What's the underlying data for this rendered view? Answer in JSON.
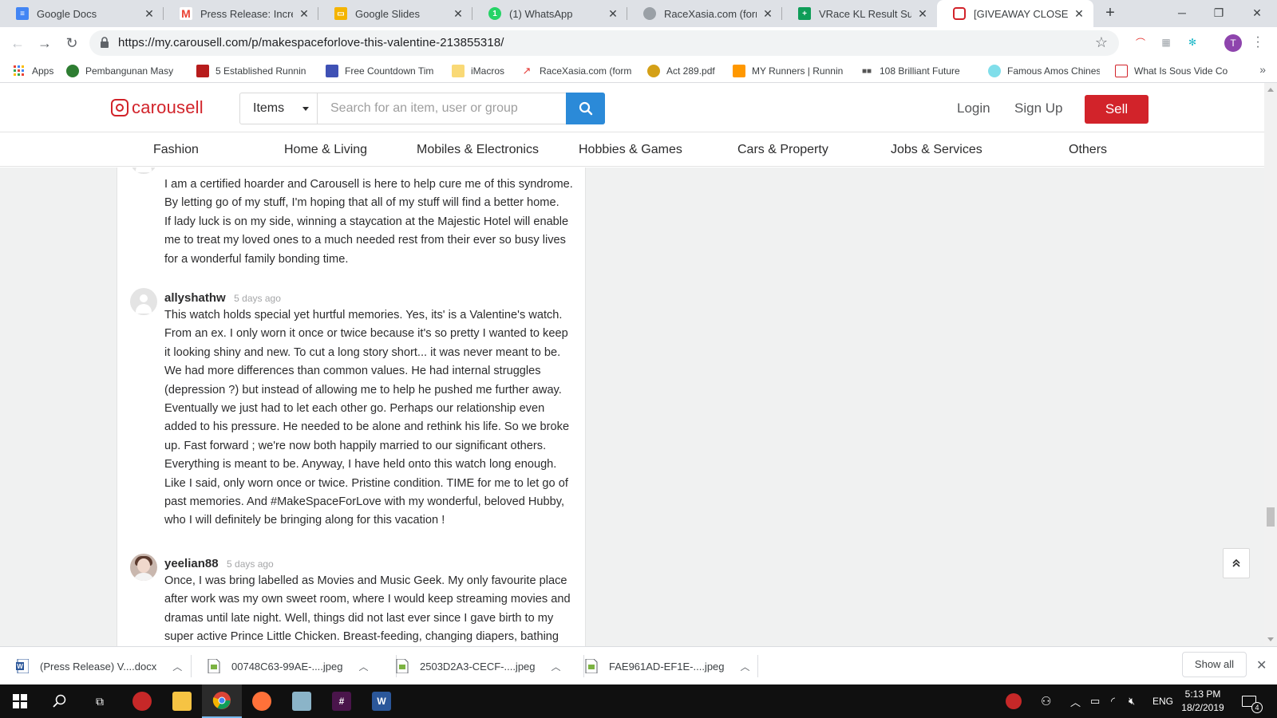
{
  "browser": {
    "tabs": [
      {
        "title": "Google Docs",
        "icon": "google-docs-icon",
        "color": "#4285f4"
      },
      {
        "title": "Press Release: Increase",
        "icon": "gmail-icon",
        "color": "#ea4335"
      },
      {
        "title": "Google Slides",
        "icon": "google-slides-icon",
        "color": "#f4b400"
      },
      {
        "title": "(1) WhatsApp",
        "icon": "whatsapp-icon",
        "color": "#25d366"
      },
      {
        "title": "RaceXasia.com (former",
        "icon": "globe-icon",
        "color": "#9aa0a6"
      },
      {
        "title": "VRace KL Result Submi",
        "icon": "google-sheets-icon",
        "color": "#0f9d58"
      },
      {
        "title": "[GIVEAWAY CLOSED] #",
        "icon": "carousell-icon",
        "color": "#d2232a"
      }
    ],
    "url": "https://my.carousell.com/p/makespaceforlove-this-valentine-213855318/",
    "profile_initial": "T",
    "bookmarks": [
      {
        "label": "Apps",
        "icon": "apps-grid-icon"
      },
      {
        "label": "Pembangunan Masy",
        "icon": "globe-icon"
      },
      {
        "label": "5 Established Runnin",
        "icon": "bookmark-page-icon"
      },
      {
        "label": "Free Countdown Tim",
        "icon": "bookmark-page-icon"
      },
      {
        "label": "iMacros",
        "icon": "folder-icon"
      },
      {
        "label": "RaceXasia.com (form",
        "icon": "bookmark-page-icon"
      },
      {
        "label": "Act 289.pdf",
        "icon": "bookmark-page-icon"
      },
      {
        "label": "MY Runners | Runnin",
        "icon": "bookmark-page-icon"
      },
      {
        "label": "108 Brilliant Future",
        "icon": "bookmark-page-icon"
      },
      {
        "label": "Famous Amos Chines",
        "icon": "bookmark-page-icon"
      },
      {
        "label": "What Is Sous Vide Co",
        "icon": "bookmark-page-icon"
      }
    ]
  },
  "site": {
    "brand": "carousell",
    "brand_color": "#d2232a",
    "accent_color": "#2b8ad8",
    "search": {
      "category": "Items",
      "placeholder": "Search for an item, user or group"
    },
    "login_label": "Login",
    "signup_label": "Sign Up",
    "sell_label": "Sell",
    "categories": [
      "Fashion",
      "Home & Living",
      "Mobiles & Electronics",
      "Hobbies & Games",
      "Cars & Property",
      "Jobs & Services",
      "Others"
    ]
  },
  "comments": [
    {
      "user": "",
      "time": "",
      "lines": [
        "I am a certified hoarder and Carousell is here to help cure me of this syndrome.",
        "By letting go of my stuff, I'm hoping that all of my stuff will find a better home.",
        "If lady luck is on my side, winning a staycation at the Majestic Hotel will enable",
        "me to treat my loved ones to a much needed rest from their ever so busy lives",
        "for a wonderful family bonding time."
      ]
    },
    {
      "user": "allyshathw",
      "time": "5 days ago",
      "lines": [
        "This watch holds special yet hurtful memories. Yes, its' is a Valentine's watch.",
        "From an ex. I only worn it once or twice because it's so pretty I wanted to keep",
        "it looking shiny and new. To cut a long story short... it was never meant to be.",
        "We had more differences than common values. He had internal struggles",
        "(depression ?) but instead of allowing me to help he pushed me further away.",
        "Eventually we just had to let each other go. Perhaps our relationship even",
        "added to his pressure. He needed to be alone and rethink his life. So we broke",
        "up. Fast forward ; we're now both happily married to our significant others.",
        "Everything is meant to be. Anyway, I have held onto this watch long enough.",
        "Like I said, only worn once or twice. Pristine condition. TIME for me to let go of",
        "past memories. And #MakeSpaceForLove with my wonderful, beloved Hubby,",
        "who I will definitely be bringing along for this vacation !"
      ]
    },
    {
      "user": "yeelian88",
      "time": "5 days ago",
      "lines": [
        "Once, I was bring labelled as Movies and Music Geek. My only favourite place",
        "after work was my own sweet room, where I would keep streaming movies and",
        "dramas until late night. Well, things did not last ever since I gave birth to my",
        "super active Prince Little Chicken. Breast-feeding, changing diapers, bathing"
      ]
    }
  ],
  "downloads": {
    "items": [
      {
        "name": "(Press Release) V....docx",
        "icon": "word-doc-icon"
      },
      {
        "name": "00748C63-99AE-....jpeg",
        "icon": "image-file-icon"
      },
      {
        "name": "2503D2A3-CECF-....jpeg",
        "icon": "image-file-icon"
      },
      {
        "name": "FAE961AD-EF1E-....jpeg",
        "icon": "image-file-icon"
      }
    ],
    "show_all_label": "Show all"
  },
  "taskbar": {
    "language": "ENG",
    "time": "5:13 PM",
    "date": "18/2/2019",
    "notification_count": "4"
  }
}
